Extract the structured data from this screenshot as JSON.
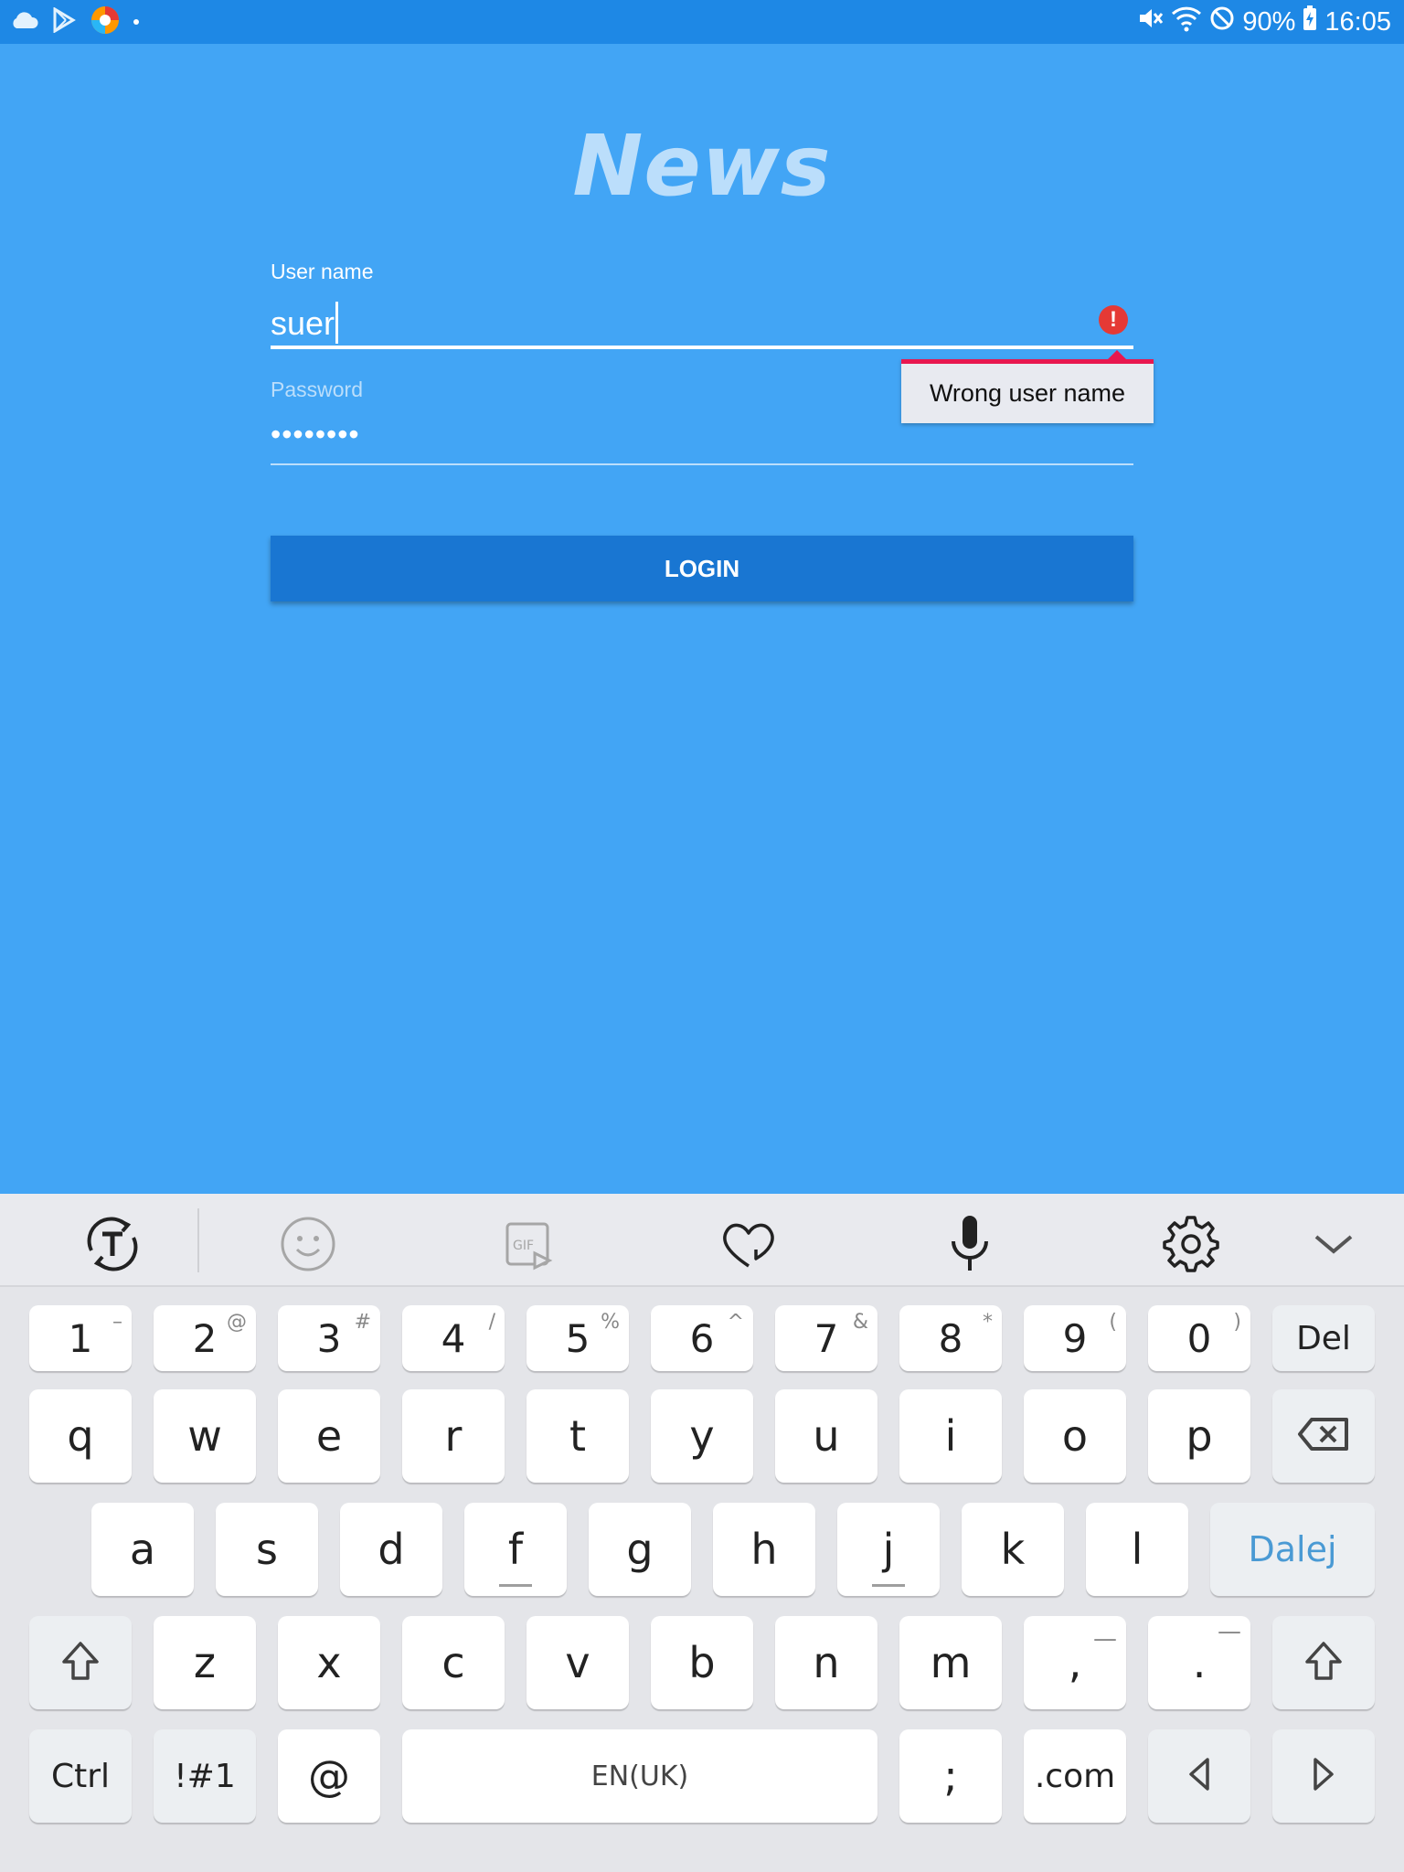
{
  "status_bar": {
    "battery": "90%",
    "time": "16:05"
  },
  "app": {
    "title": "News",
    "user_label": "User name",
    "user_value": "suer",
    "error_tooltip": "Wrong user name",
    "pass_label": "Password",
    "pass_value": "••••••••",
    "login_label": "LOGIN"
  },
  "keyboard": {
    "row_numbers": [
      {
        "main": "1",
        "hint": "–"
      },
      {
        "main": "2",
        "hint": "@"
      },
      {
        "main": "3",
        "hint": "#"
      },
      {
        "main": "4",
        "hint": "/"
      },
      {
        "main": "5",
        "hint": "%"
      },
      {
        "main": "6",
        "hint": "^"
      },
      {
        "main": "7",
        "hint": "&"
      },
      {
        "main": "8",
        "hint": "*"
      },
      {
        "main": "9",
        "hint": "("
      },
      {
        "main": "0",
        "hint": ")"
      }
    ],
    "del_label": "Del",
    "row_q": [
      "q",
      "w",
      "e",
      "r",
      "t",
      "y",
      "u",
      "i",
      "o",
      "p"
    ],
    "row_a": [
      "a",
      "s",
      "d",
      "f",
      "g",
      "h",
      "j",
      "k",
      "l"
    ],
    "enter_label": "Dalej",
    "row_z": [
      "z",
      "x",
      "c",
      "v",
      "b",
      "n",
      "m"
    ],
    "comma": {
      "main": ",",
      "hint": "—"
    },
    "period": {
      "main": ".",
      "hint": "—"
    },
    "ctrl_label": "Ctrl",
    "sym_label": "!#1",
    "at_label": "@",
    "space_label": "EN(UK)",
    "semicolon": ";",
    "dotcom": ".com",
    "accent": "#4a9ad4"
  }
}
